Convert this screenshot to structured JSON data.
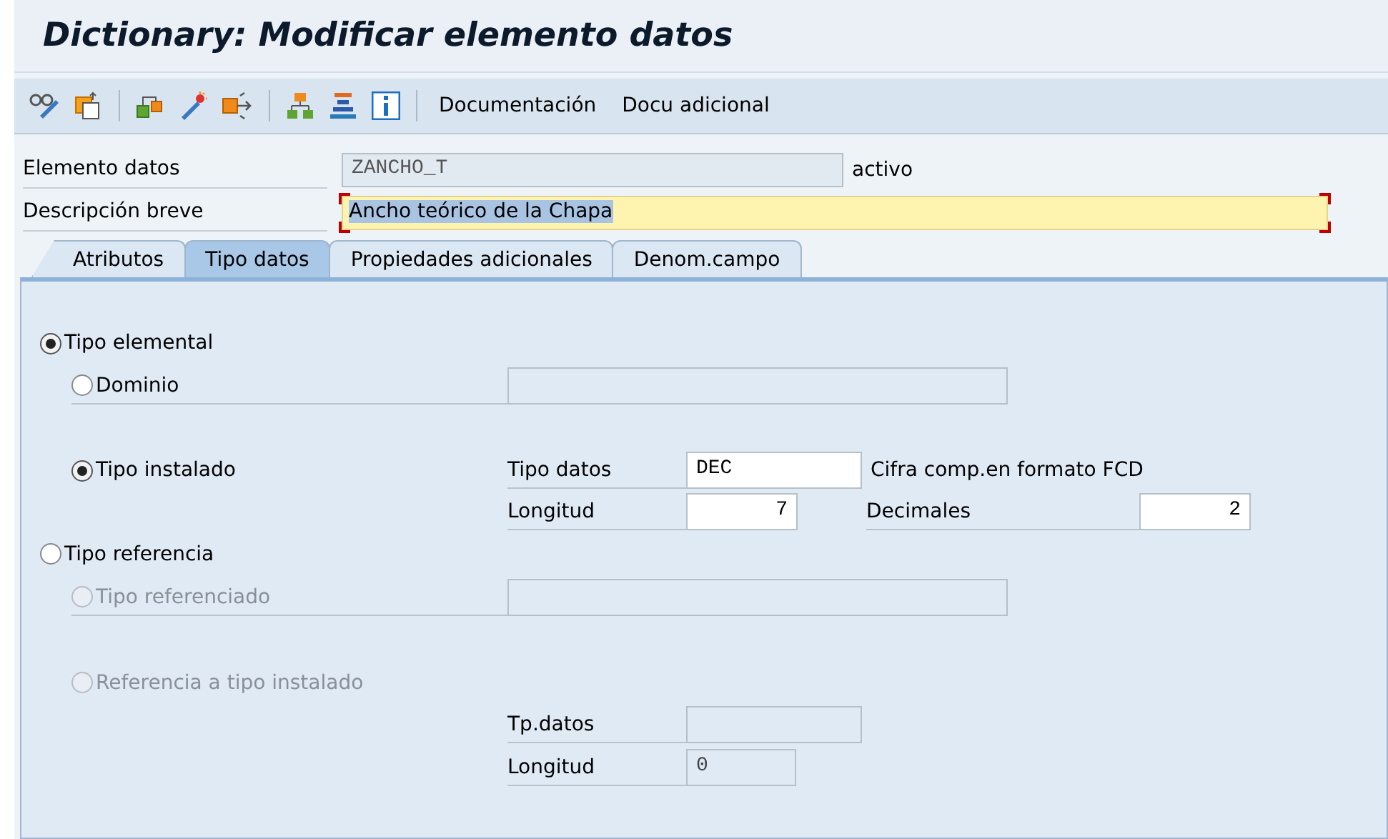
{
  "window": {
    "title": "Dictionary: Modificar elemento datos"
  },
  "toolbar": {
    "buttons": [
      "Documentación",
      "Docu adicional"
    ]
  },
  "header": [
    {
      "label": "Elemento datos",
      "value": "ZANCHO_T",
      "disabled": true,
      "status": "activo"
    },
    {
      "label": "Descripción breve",
      "value": "Ancho teórico de la Chapa",
      "disabled": false,
      "required": true,
      "focused": true
    }
  ],
  "tabs": [
    {
      "label": "Atributos",
      "selected": false
    },
    {
      "label": "Tipo datos",
      "selected": true
    },
    {
      "label": "Propiedades adicionales",
      "selected": false
    },
    {
      "label": "Denom.campo",
      "selected": false
    }
  ],
  "categories": [
    {
      "label": "Tipo elemental",
      "selected": true,
      "disabled": false,
      "children": [
        {
          "label": "Dominio",
          "selected": false,
          "disabled": false,
          "fields": [
            {
              "disabled": true
            }
          ]
        },
        {
          "label": "Tipo instalado",
          "selected": true,
          "disabled": false,
          "fields": [
            {
              "label": "Tipo datos",
              "value": "DEC",
              "disabled": false,
              "note": "Cifra comp.en formato FCD"
            },
            {
              "label": "Longitud",
              "value": "7",
              "disabled": false
            },
            {
              "label": "Decimales",
              "value": "2",
              "disabled": false
            }
          ]
        }
      ]
    },
    {
      "label": "Tipo referencia",
      "selected": false,
      "disabled": false,
      "children": [
        {
          "label": "Tipo referenciado",
          "selected": false,
          "disabled": true,
          "fields": [
            {
              "disabled": true
            }
          ]
        },
        {
          "label": "Referencia a tipo instalado",
          "selected": false,
          "disabled": true,
          "fields": [
            {
              "label": "Tp.datos",
              "disabled": true
            },
            {
              "label": "Longitud",
              "value": "0",
              "disabled": true
            }
          ]
        }
      ]
    }
  ]
}
